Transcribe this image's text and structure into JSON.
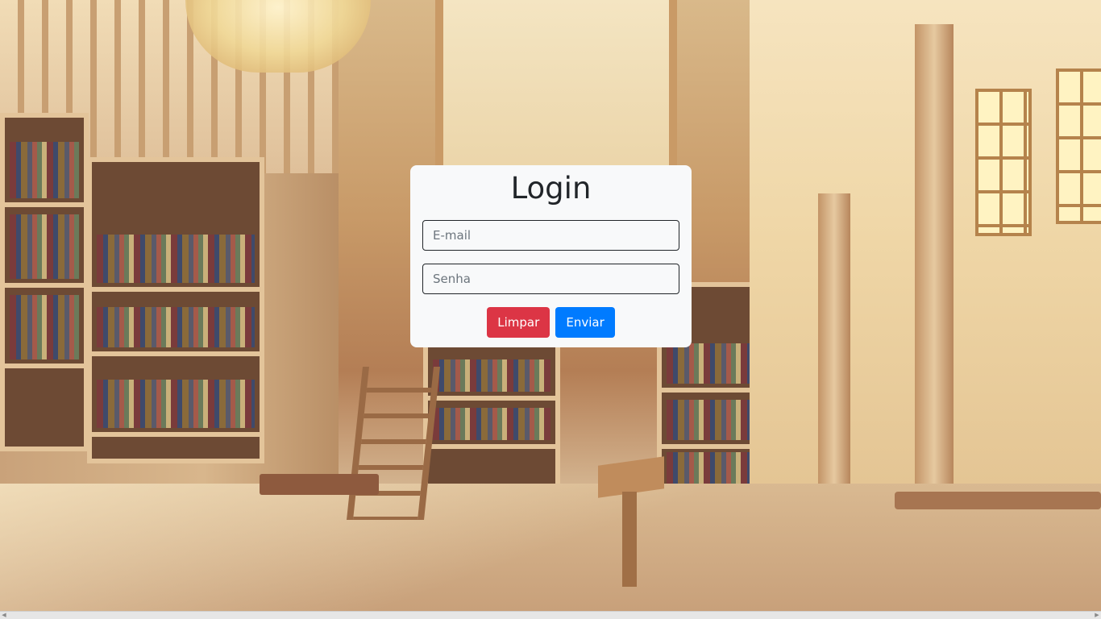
{
  "login": {
    "title": "Login",
    "email_placeholder": "E-mail",
    "email_value": "",
    "password_placeholder": "Senha",
    "password_value": "",
    "clear_label": "Limpar",
    "submit_label": "Enviar"
  },
  "colors": {
    "card_background": "#f8f9fa",
    "clear_button": "#dc3545",
    "submit_button": "#007bff",
    "title_text": "#212529"
  },
  "background": {
    "description_icon": "library-illustration"
  },
  "scrollbar": {
    "left_arrow_icon": "chevron-left-icon",
    "right_arrow_icon": "chevron-right-icon"
  }
}
